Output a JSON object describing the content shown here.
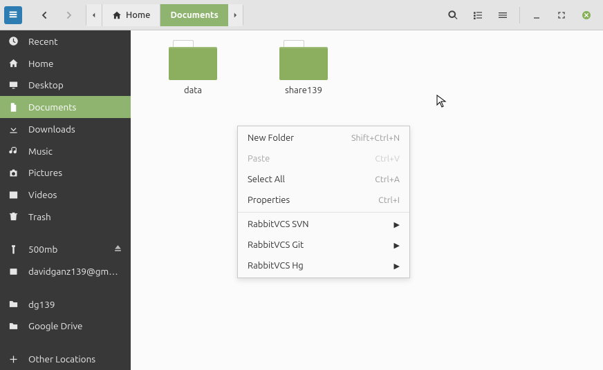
{
  "pathbar": {
    "home": "Home",
    "current": "Documents"
  },
  "sidebar": {
    "recent": "Recent",
    "home": "Home",
    "desktop": "Desktop",
    "documents": "Documents",
    "downloads": "Downloads",
    "music": "Music",
    "pictures": "Pictures",
    "videos": "Videos",
    "trash": "Trash",
    "drive": "500mb",
    "account": "davidganz139@gm…",
    "dg": "dg139",
    "gdrive": "Google Drive",
    "other": "Other Locations"
  },
  "folders": [
    {
      "name": "data"
    },
    {
      "name": "share139"
    }
  ],
  "menu": {
    "newfolder": {
      "label": "New Folder",
      "shortcut": "Shift+Ctrl+N"
    },
    "paste": {
      "label": "Paste",
      "shortcut": "Ctrl+V"
    },
    "selectall": {
      "label": "Select All",
      "shortcut": "Ctrl+A"
    },
    "properties": {
      "label": "Properties",
      "shortcut": "Ctrl+I"
    },
    "svn": {
      "label": "RabbitVCS SVN"
    },
    "git": {
      "label": "RabbitVCS Git"
    },
    "hg": {
      "label": "RabbitVCS Hg"
    }
  }
}
